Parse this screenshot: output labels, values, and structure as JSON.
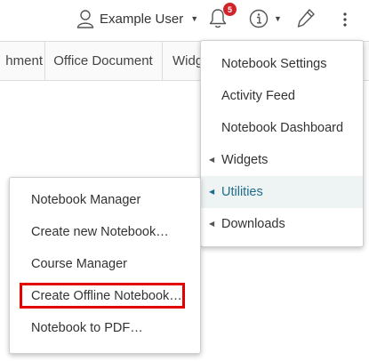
{
  "header": {
    "user_name": "Example User",
    "notifications_count": "5"
  },
  "tabs": [
    {
      "label": "hment"
    },
    {
      "label": "Office Document"
    },
    {
      "label": "Widg"
    }
  ],
  "main_menu": {
    "items": [
      {
        "label": "Notebook Settings"
      },
      {
        "label": "Activity Feed"
      },
      {
        "label": "Notebook Dashboard"
      },
      {
        "label": "Widgets",
        "submenu": true
      },
      {
        "label": "Utilities",
        "submenu": true,
        "active": true
      },
      {
        "label": "Downloads",
        "submenu": true
      }
    ]
  },
  "utilities_menu": {
    "items": [
      {
        "label": "Notebook Manager"
      },
      {
        "label": "Create new Notebook…"
      },
      {
        "label": "Course Manager"
      },
      {
        "label": "Create Offline Notebook…",
        "highlighted": true
      },
      {
        "label": "Notebook to PDF…"
      }
    ]
  },
  "colors": {
    "badge": "#d2232a",
    "active_item_text": "#1f6d88",
    "active_item_bg": "#eef3f4",
    "highlight_border": "#e30000"
  }
}
